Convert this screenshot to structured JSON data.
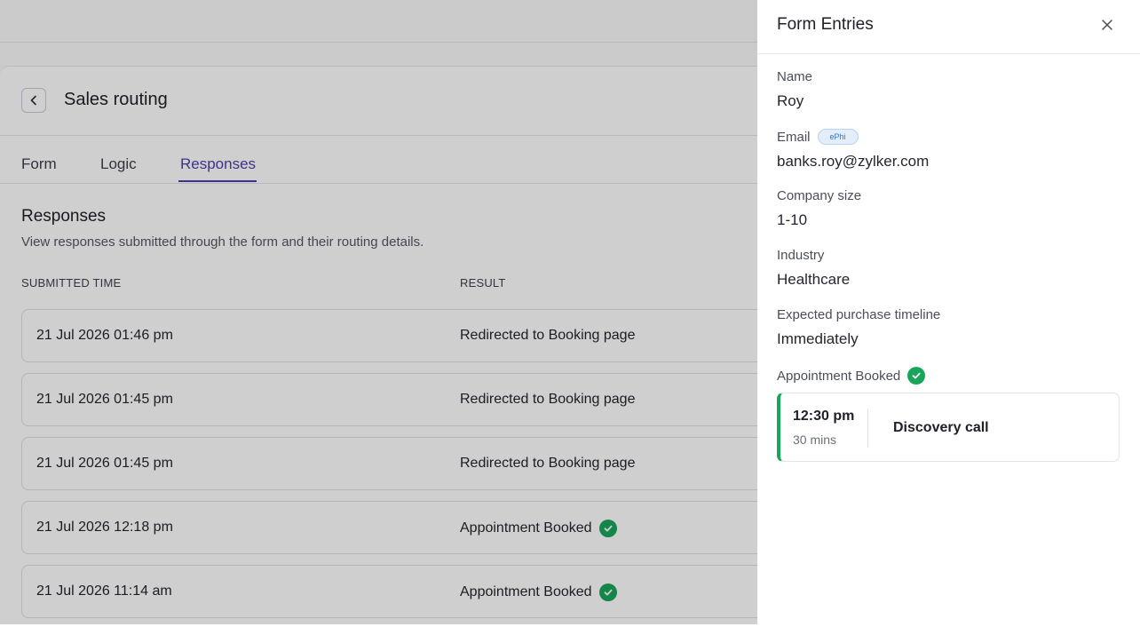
{
  "header": {
    "title": "Sales routing",
    "back_icon": "chevron-left-icon"
  },
  "tabs": [
    {
      "label": "Form",
      "active": false
    },
    {
      "label": "Logic",
      "active": false
    },
    {
      "label": "Responses",
      "active": true
    }
  ],
  "responses_section": {
    "title": "Responses",
    "subtitle": "View responses submitted through the form and their routing details.",
    "columns": {
      "submitted_time": "SUBMITTED TIME",
      "result": "RESULT"
    },
    "rows": [
      {
        "time": "21 Jul 2026 01:46 pm",
        "result": "Redirected to Booking page",
        "booked": false
      },
      {
        "time": "21 Jul 2026 01:45 pm",
        "result": "Redirected to Booking page",
        "booked": false
      },
      {
        "time": "21 Jul 2026 01:45 pm",
        "result": "Redirected to Booking page",
        "booked": false
      },
      {
        "time": "21 Jul 2026 12:18 pm",
        "result": "Appointment Booked",
        "booked": true
      },
      {
        "time": "21 Jul 2026 11:14 am",
        "result": "Appointment Booked",
        "booked": true
      }
    ]
  },
  "panel": {
    "title": "Form Entries",
    "close_icon": "close-icon",
    "fields": [
      {
        "label": "Name",
        "value": "Roy"
      },
      {
        "label": "Email",
        "value": "banks.roy@zylker.com",
        "badge": "ePhi"
      },
      {
        "label": "Company size",
        "value": "1-10"
      },
      {
        "label": "Industry",
        "value": "Healthcare"
      },
      {
        "label": "Expected purchase timeline",
        "value": "Immediately"
      }
    ],
    "appointment": {
      "label": "Appointment Booked",
      "time": "12:30 pm",
      "duration": "30 mins",
      "name": "Discovery call"
    }
  },
  "colors": {
    "accent": "#4b3fa8",
    "success": "#1aa65a",
    "badge_bg": "#e3eefc",
    "badge_text": "#3a6fc8"
  }
}
